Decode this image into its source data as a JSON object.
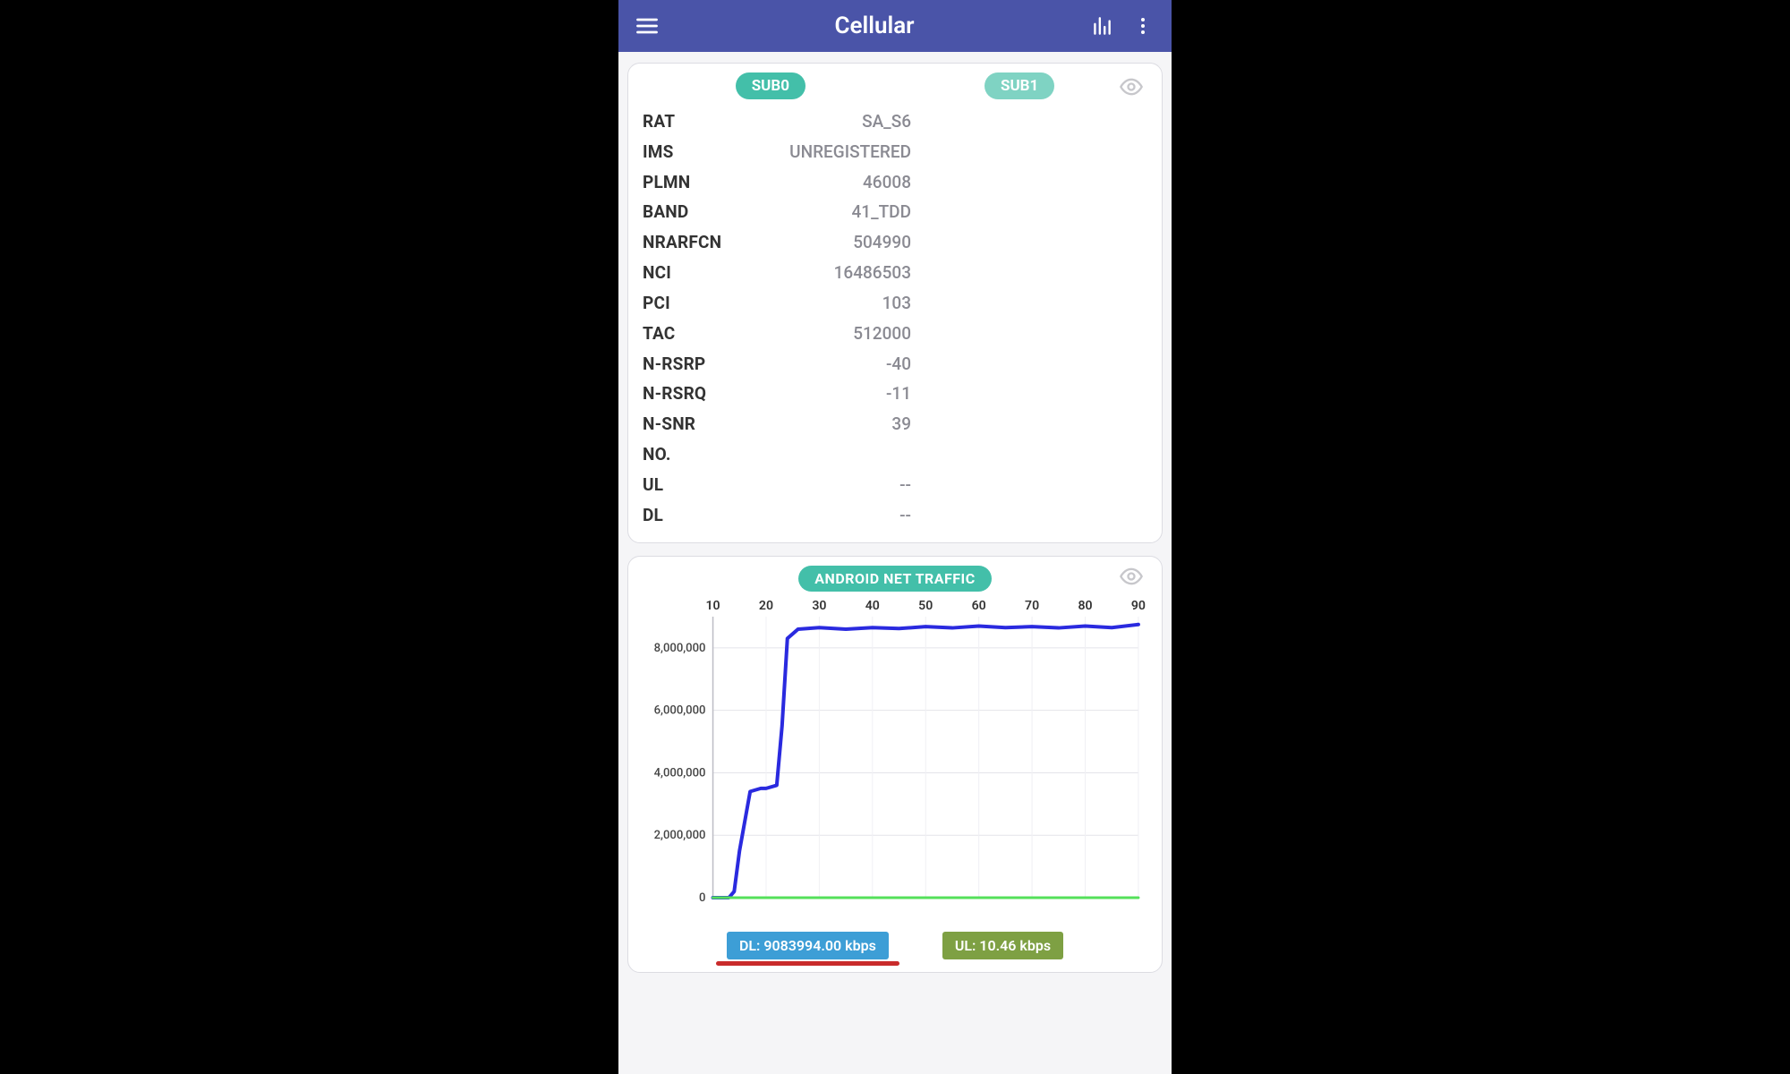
{
  "header": {
    "title": "Cellular"
  },
  "subs": {
    "sub0": "SUB0",
    "sub1": "SUB1"
  },
  "metrics": [
    {
      "label": "RAT",
      "value": "SA_S6"
    },
    {
      "label": "IMS",
      "value": "UNREGISTERED"
    },
    {
      "label": "PLMN",
      "value": "46008"
    },
    {
      "label": "BAND",
      "value": "41_TDD"
    },
    {
      "label": "NRARFCN",
      "value": "504990"
    },
    {
      "label": "NCI",
      "value": "16486503"
    },
    {
      "label": "PCI",
      "value": "103"
    },
    {
      "label": "TAC",
      "value": "512000"
    },
    {
      "label": "N-RSRP",
      "value": "-40"
    },
    {
      "label": "N-RSRQ",
      "value": "-11"
    },
    {
      "label": "N-SNR",
      "value": "39"
    },
    {
      "label": "NO.",
      "value": ""
    },
    {
      "label": "UL",
      "value": "--"
    },
    {
      "label": "DL",
      "value": "--"
    }
  ],
  "traffic": {
    "title": "ANDROID NET TRAFFIC",
    "dl_label": "DL: 9083994.00 kbps",
    "ul_label": "UL: 10.46 kbps"
  },
  "chart_data": {
    "type": "line",
    "title": "ANDROID NET TRAFFIC",
    "xlabel": "",
    "ylabel": "",
    "xlim": [
      10,
      90
    ],
    "ylim": [
      0,
      9000000
    ],
    "x_ticks": [
      10,
      20,
      30,
      40,
      50,
      60,
      70,
      80,
      90
    ],
    "y_ticks": [
      0,
      2000000,
      4000000,
      6000000,
      8000000
    ],
    "y_tick_labels": [
      "0",
      "2,000,000",
      "4,000,000",
      "6,000,000",
      "8,000,000"
    ],
    "series": [
      {
        "name": "DL",
        "color": "#2a2adf",
        "x": [
          10,
          13,
          14,
          15,
          17,
          19,
          20,
          22,
          23,
          24,
          26,
          30,
          35,
          40,
          45,
          50,
          55,
          60,
          65,
          70,
          75,
          80,
          85,
          90
        ],
        "values": [
          0,
          0,
          200000,
          1500000,
          3400000,
          3500000,
          3500000,
          3600000,
          5500000,
          8300000,
          8600000,
          8650000,
          8600000,
          8650000,
          8620000,
          8680000,
          8640000,
          8700000,
          8650000,
          8680000,
          8640000,
          8700000,
          8650000,
          8750000
        ]
      },
      {
        "name": "UL",
        "color": "#54e05a",
        "x": [
          10,
          90
        ],
        "values": [
          10,
          10
        ]
      }
    ]
  }
}
